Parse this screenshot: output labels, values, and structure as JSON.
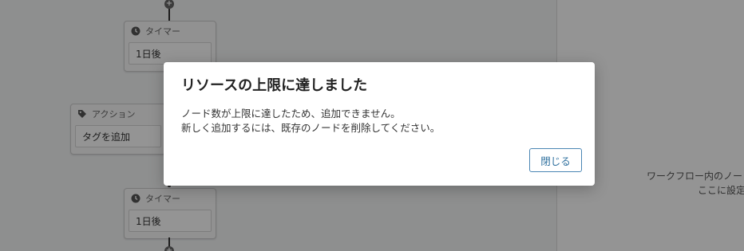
{
  "workflow": {
    "nodes": [
      {
        "type_label": "タイマー",
        "value": "1日後",
        "icon": "clock-icon"
      },
      {
        "type_label": "アクション",
        "value": "タグを追加",
        "icon": "tag-icon"
      },
      {
        "type_label": "タイマー",
        "value": "1日後",
        "icon": "clock-icon"
      }
    ]
  },
  "side_panel": {
    "line1": "ワークフロー内のノー",
    "line2": "ここに設定"
  },
  "modal": {
    "title": "リソースの上限に達しました",
    "message_line1": "ノード数が上限に達したため、追加できません。",
    "message_line2": "新しく追加するには、既存のノードを削除してください。",
    "close_label": "閉じる"
  },
  "colors": {
    "overlay": "rgba(0,0,0,0.42)",
    "button_border": "#4a86b4",
    "button_text": "#2d6f9e"
  }
}
